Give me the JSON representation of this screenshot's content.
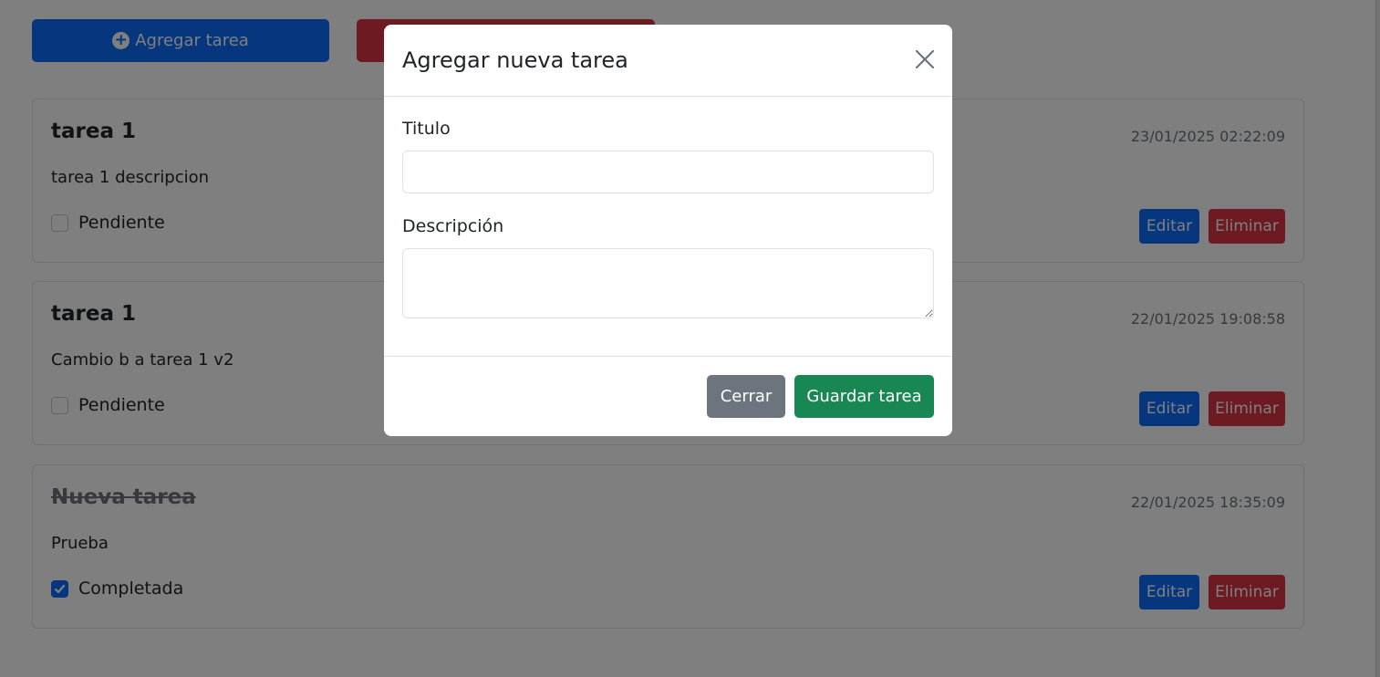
{
  "toolbar": {
    "add_label": "Agregar tarea",
    "delete_all_label": ""
  },
  "tasks": [
    {
      "title": "tarea 1",
      "description": "tarea 1 descripcion",
      "date": "23/01/2025 02:22:09",
      "status": "Pendiente",
      "completed": false,
      "edit_label": "Editar",
      "delete_label": "Eliminar"
    },
    {
      "title": "tarea 1",
      "description": "Cambio b a tarea 1 v2",
      "date": "22/01/2025 19:08:58",
      "status": "Pendiente",
      "completed": false,
      "edit_label": "Editar",
      "delete_label": "Eliminar"
    },
    {
      "title": "Nueva tarea",
      "description": "Prueba",
      "date": "22/01/2025 18:35:09",
      "status": "Completada",
      "completed": true,
      "edit_label": "Editar",
      "delete_label": "Eliminar"
    }
  ],
  "modal": {
    "title": "Agregar nueva tarea",
    "title_label": "Titulo",
    "title_value": "",
    "description_label": "Descripción",
    "description_value": "",
    "close_label": "Cerrar",
    "save_label": "Guardar tarea"
  },
  "colors": {
    "primary": "#0d6efd",
    "danger": "#dc3545",
    "secondary": "#6c757d",
    "success": "#198754"
  }
}
